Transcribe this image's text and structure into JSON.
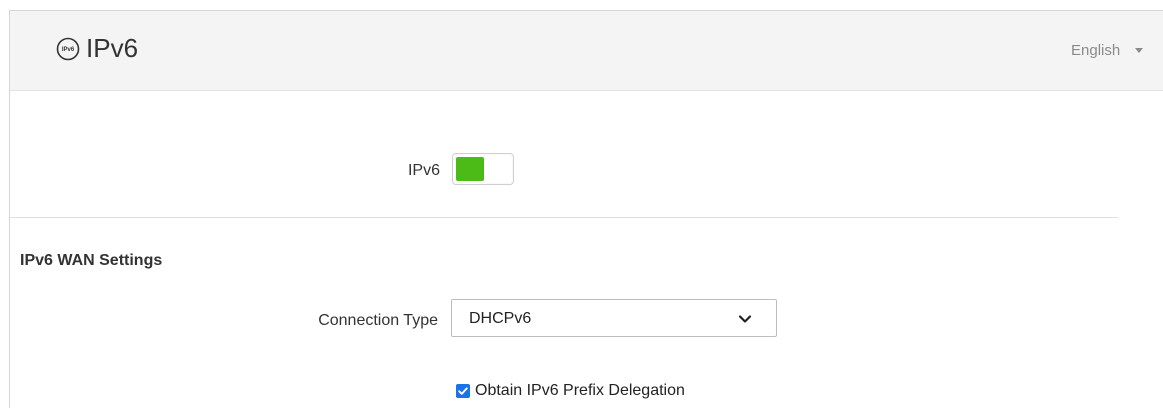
{
  "header": {
    "title": "IPv6",
    "icon_text": "IPv6",
    "language": "English"
  },
  "ipv6_toggle": {
    "label": "IPv6",
    "enabled": true,
    "on_color": "#4cbb17"
  },
  "wan_settings": {
    "section_title": "IPv6 WAN Settings",
    "connection_type": {
      "label": "Connection Type",
      "value": "DHCPv6"
    },
    "prefix_delegation": {
      "label": "Obtain IPv6 Prefix Delegation",
      "checked": true,
      "color": "#1a73e8"
    }
  }
}
